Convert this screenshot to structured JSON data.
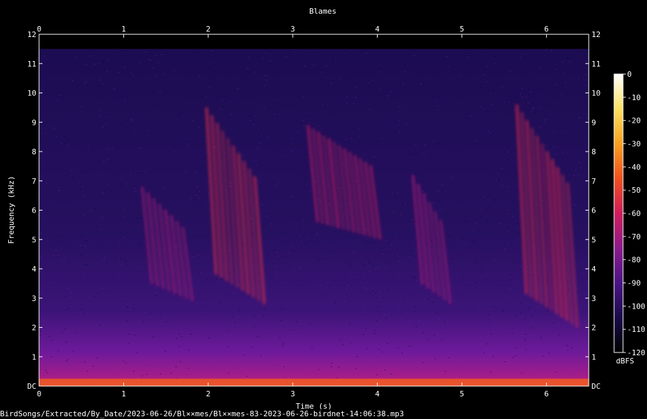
{
  "chart_data": {
    "type": "heatmap",
    "title": "Blames",
    "xlabel": "Time (s)",
    "ylabel": "Frequency (kHz)",
    "xlim": [
      0,
      6.5
    ],
    "ylim": [
      0,
      12
    ],
    "x_ticks": [
      {
        "value": 0,
        "label": "0"
      },
      {
        "value": 1,
        "label": "1"
      },
      {
        "value": 2,
        "label": "2"
      },
      {
        "value": 3,
        "label": "3"
      },
      {
        "value": 4,
        "label": "4"
      },
      {
        "value": 5,
        "label": "5"
      },
      {
        "value": 6,
        "label": "6"
      }
    ],
    "y_ticks": [
      {
        "value": 0,
        "label": "DC"
      },
      {
        "value": 1,
        "label": "1"
      },
      {
        "value": 2,
        "label": "2"
      },
      {
        "value": 3,
        "label": "3"
      },
      {
        "value": 4,
        "label": "4"
      },
      {
        "value": 5,
        "label": "5"
      },
      {
        "value": 6,
        "label": "6"
      },
      {
        "value": 7,
        "label": "7"
      },
      {
        "value": 8,
        "label": "8"
      },
      {
        "value": 9,
        "label": "9"
      },
      {
        "value": 10,
        "label": "10"
      },
      {
        "value": 11,
        "label": "11"
      },
      {
        "value": 12,
        "label": "12"
      }
    ],
    "colorbar": {
      "unit": "dBFS",
      "range": [
        -120,
        0
      ],
      "ticks": [
        0,
        -10,
        -20,
        -30,
        -40,
        -50,
        -60,
        -70,
        -80,
        -90,
        -100,
        -110,
        -120
      ],
      "colors": [
        "#000000",
        "#1a0a4a",
        "#4a1486",
        "#8c1a8c",
        "#d01c5a",
        "#f0501e",
        "#f8a020",
        "#fce060",
        "#ffffff"
      ]
    },
    "noise_floor_khz": 11.5,
    "calls": [
      {
        "t_start": 1.22,
        "t_end": 1.7,
        "f_low": 2.9,
        "f_high": 6.8,
        "peak_db": -68
      },
      {
        "t_start": 1.98,
        "t_end": 2.55,
        "f_low": 2.8,
        "f_high": 9.5,
        "peak_db": -55
      },
      {
        "t_start": 3.18,
        "t_end": 3.92,
        "f_low": 5.0,
        "f_high": 8.9,
        "peak_db": -62
      },
      {
        "t_start": 4.42,
        "t_end": 4.75,
        "f_low": 2.8,
        "f_high": 7.2,
        "peak_db": -68
      },
      {
        "t_start": 5.65,
        "t_end": 6.25,
        "f_low": 2.0,
        "f_high": 9.6,
        "peak_db": -56
      }
    ],
    "grid": false
  },
  "footer_text": "BirdSongs/Extracted/By_Date/2023-06-26/Bl××mes/Bl××mes-83-2023-06-26-birdnet-14:06:38.mp3"
}
